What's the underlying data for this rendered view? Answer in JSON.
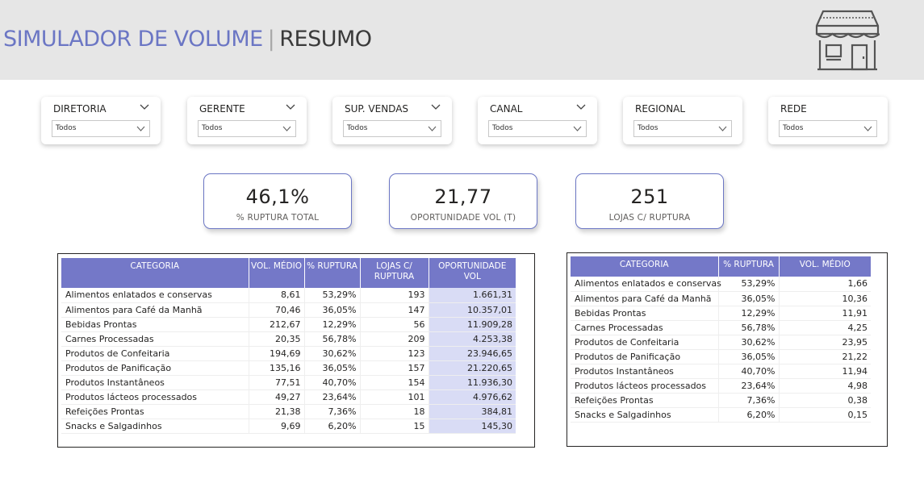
{
  "header": {
    "title_main": "SIMULADOR DE VOLUME",
    "title_separator": "|",
    "title_sub": "RESUMO",
    "icon": "store-icon"
  },
  "filters": [
    {
      "label": "DIRETORIA",
      "value": "Todos"
    },
    {
      "label": "GERENTE",
      "value": "Todos"
    },
    {
      "label": "SUP. VENDAS",
      "value": "Todos"
    },
    {
      "label": "CANAL",
      "value": "Todos"
    },
    {
      "label": "REGIONAL",
      "value": "Todos"
    },
    {
      "label": "REDE",
      "value": "Todos"
    }
  ],
  "kpis": [
    {
      "value": "46,1%",
      "caption": "% RUPTURA TOTAL"
    },
    {
      "value": "21,77",
      "caption": "OPORTUNIDADE VOL (T)"
    },
    {
      "value": "251",
      "caption": "LOJAS C/ RUPTURA"
    }
  ],
  "table1": {
    "headers": [
      "CATEGORIA",
      "VOL. MÉDIO",
      "% RUPTURA",
      "LOJAS C/ RUPTURA",
      "OPORTUNIDADE VOL"
    ],
    "rows": [
      [
        "Alimentos enlatados e conservas",
        "8,61",
        "53,29%",
        "193",
        "1.661,31"
      ],
      [
        "Alimentos para Café da Manhã",
        "70,46",
        "36,05%",
        "147",
        "10.357,01"
      ],
      [
        "Bebidas Prontas",
        "212,67",
        "12,29%",
        "56",
        "11.909,28"
      ],
      [
        "Carnes Processadas",
        "20,35",
        "56,78%",
        "209",
        "4.253,38"
      ],
      [
        "Produtos de Confeitaria",
        "194,69",
        "30,62%",
        "123",
        "23.946,65"
      ],
      [
        "Produtos de Panificação",
        "135,16",
        "36,05%",
        "157",
        "21.220,65"
      ],
      [
        "Produtos Instantâneos",
        "77,51",
        "40,70%",
        "154",
        "11.936,30"
      ],
      [
        "Produtos lácteos processados",
        "49,27",
        "23,64%",
        "101",
        "4.976,62"
      ],
      [
        "Refeições Prontas",
        "21,38",
        "7,36%",
        "18",
        "384,81"
      ],
      [
        "Snacks e Salgadinhos",
        "9,69",
        "6,20%",
        "15",
        "145,30"
      ]
    ]
  },
  "table2": {
    "headers": [
      "CATEGORIA",
      "% RUPTURA",
      "VOL. MÉDIO"
    ],
    "rows": [
      [
        "Alimentos enlatados e conservas",
        "53,29%",
        "1,66"
      ],
      [
        "Alimentos para Café da Manhã",
        "36,05%",
        "10,36"
      ],
      [
        "Bebidas Prontas",
        "12,29%",
        "11,91"
      ],
      [
        "Carnes Processadas",
        "56,78%",
        "4,25"
      ],
      [
        "Produtos de Confeitaria",
        "30,62%",
        "23,95"
      ],
      [
        "Produtos de Panificação",
        "36,05%",
        "21,22"
      ],
      [
        "Produtos Instantâneos",
        "40,70%",
        "11,94"
      ],
      [
        "Produtos lácteos processados",
        "23,64%",
        "4,98"
      ],
      [
        "Refeições Prontas",
        "7,36%",
        "0,38"
      ],
      [
        "Snacks e Salgadinhos",
        "6,20%",
        "0,15"
      ]
    ]
  },
  "colors": {
    "accent": "#6b76c4",
    "table_header": "#7478c8",
    "highlight_column": "#d9dcf5",
    "header_band": "#e6e6e6"
  }
}
